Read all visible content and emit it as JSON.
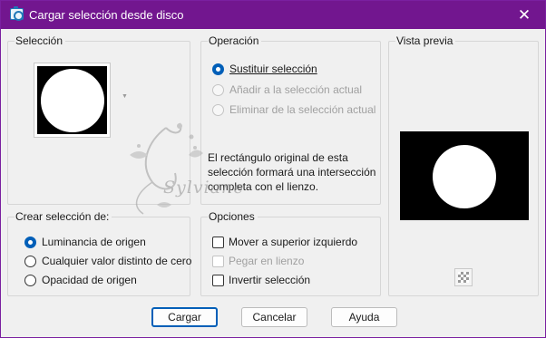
{
  "window": {
    "title": "Cargar selección desde disco",
    "close_symbol": "✕"
  },
  "seleccion": {
    "label": "Selección"
  },
  "operacion": {
    "label": "Operación",
    "options": [
      {
        "label": "Sustituir selección",
        "checked": true,
        "enabled": true
      },
      {
        "label": "Añadir a la selección actual",
        "checked": false,
        "enabled": false
      },
      {
        "label": "Eliminar de la selección actual",
        "checked": false,
        "enabled": false
      }
    ],
    "info_lines": [
      "El rectángulo original de esta",
      "selección formará una intersección",
      "completa con el lienzo."
    ]
  },
  "vista_previa": {
    "label": "Vista previa",
    "transparency_icon": "checkerboard-icon"
  },
  "crear_seleccion": {
    "label": "Crear selección de:",
    "options": [
      {
        "label": "Luminancia de origen",
        "checked": true,
        "enabled": true
      },
      {
        "label": "Cualquier valor distinto de cero",
        "checked": false,
        "enabled": true
      },
      {
        "label": "Opacidad de origen",
        "checked": false,
        "enabled": true
      }
    ]
  },
  "opciones": {
    "label": "Opciones",
    "checkboxes": [
      {
        "label": "Mover a superior izquierdo",
        "checked": false,
        "enabled": true
      },
      {
        "label": "Pegar en lienzo",
        "checked": false,
        "enabled": false
      },
      {
        "label": "Invertir selección",
        "checked": false,
        "enabled": true
      }
    ]
  },
  "buttons": {
    "load": "Cargar",
    "cancel": "Cancelar",
    "help": "Ayuda"
  },
  "watermark": {
    "text": "Sylviane"
  },
  "colors": {
    "titlebar": "#72168f",
    "accent": "#005fb8",
    "background": "#f0f0f0"
  }
}
